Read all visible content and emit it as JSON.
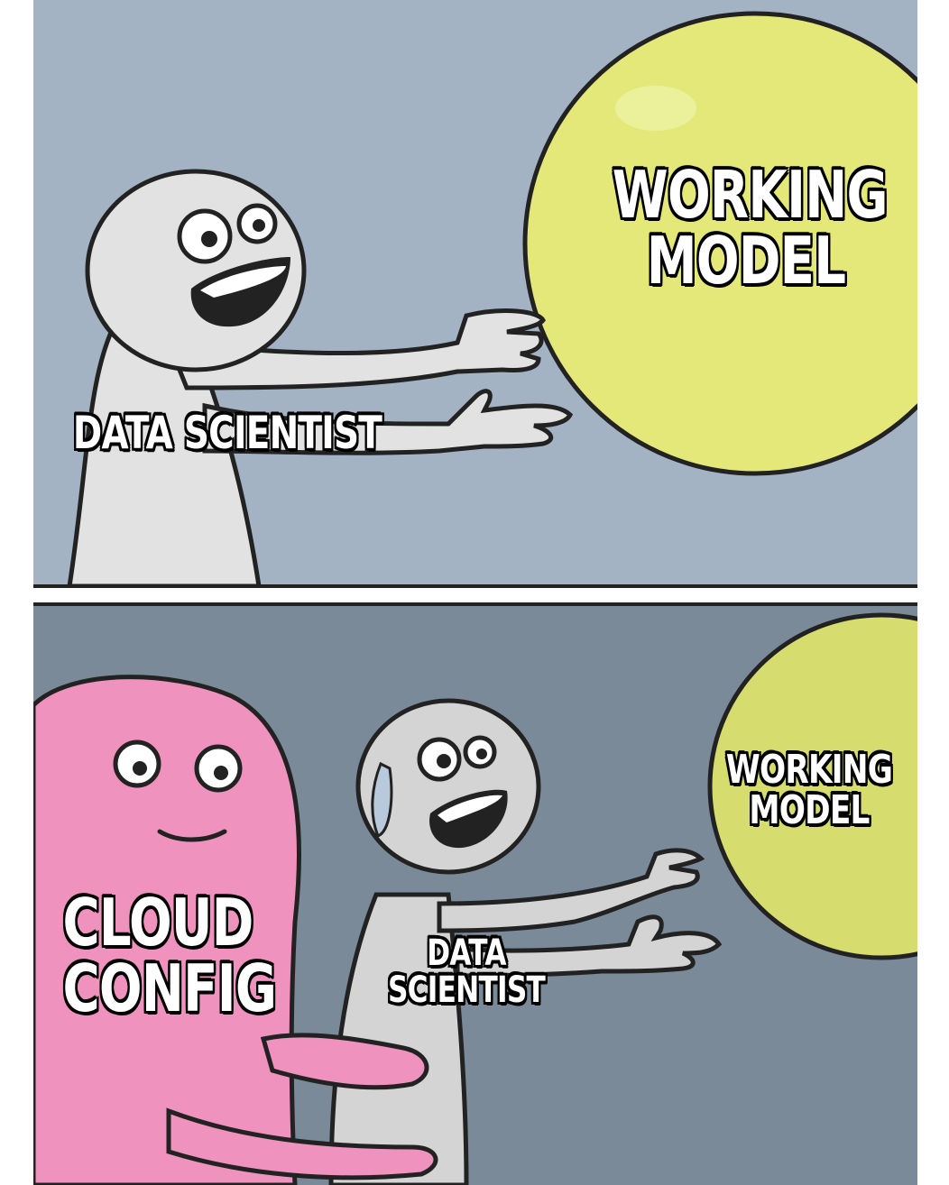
{
  "panels": [
    {
      "captions": {
        "goal": "WORKING\nMODEL",
        "runner": "DATA SCIENTIST"
      },
      "colors": {
        "background": "#a3b3c4",
        "ball": "#e3e879",
        "runner": "#e2e2e2"
      }
    },
    {
      "captions": {
        "goal": "WORKING\nMODEL",
        "runner": "DATA SCIENTIST",
        "holder": "CLOUD\nCONFIG"
      },
      "colors": {
        "background": "#7a8a99",
        "ball": "#d6dc6e",
        "runner": "#d4d4d4",
        "holder": "#ef92bd"
      }
    }
  ]
}
